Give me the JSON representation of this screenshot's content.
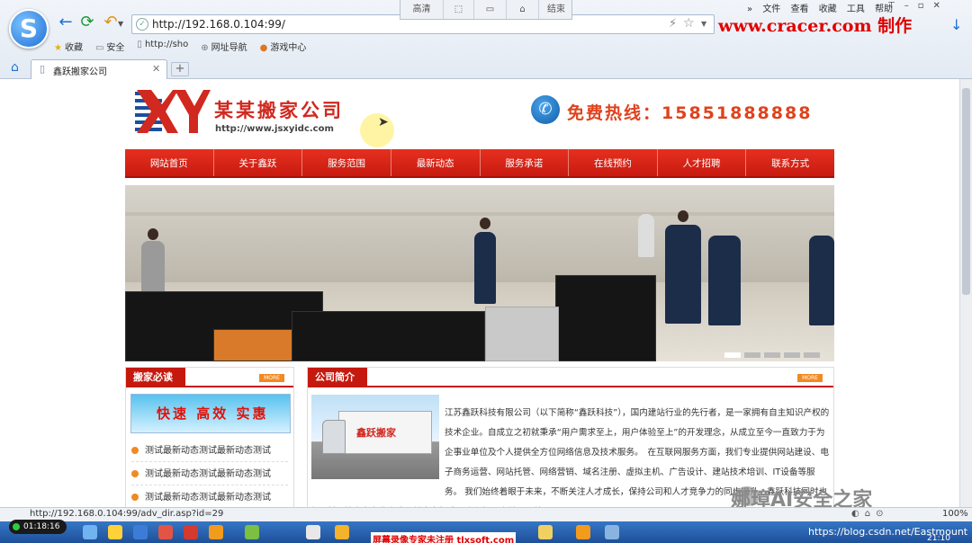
{
  "browser": {
    "url": "http://192.168.0.104:99/",
    "toolset": [
      "高清",
      "",
      "",
      "",
      "结束"
    ],
    "menu": [
      "文件",
      "查看",
      "收藏",
      "工具",
      "帮助"
    ],
    "watermark": "www.cracer.com 制作",
    "favorites": [
      "收藏",
      "安全",
      "http://sho",
      "网址导航",
      "游戏中心"
    ],
    "tab_title": "鑫跃搬家公司",
    "status_url": "http://192.168.0.104:99/adv_dir.asp?id=29",
    "zoom": "100%"
  },
  "site": {
    "company_name": "某某搬家公司",
    "site_url": "http://www.jsxyidc.com",
    "hotline": "免费热线：15851888888",
    "nav": [
      "网站首页",
      "关于鑫跃",
      "服务范围",
      "最新动态",
      "服务承诺",
      "在线预约",
      "人才招聘",
      "联系方式"
    ],
    "left_panel": {
      "title": "搬家必读",
      "more": "MORE",
      "promo": "快速 高效 实惠",
      "news": [
        "测试最新动态测试最新动态测试",
        "测试最新动态测试最新动态测试",
        "测试最新动态测试最新动态测试"
      ]
    },
    "right_panel": {
      "title": "公司简介",
      "more": "MORE",
      "truck_label": "鑫跃搬家",
      "intro": "江苏鑫跃科技有限公司（以下简称“鑫跃科技”），国内建站行业的先行者，是一家拥有自主知识产权的技术企业。自成立之初就秉承“用户需求至上，用户体验至上”的开发理念，从成立至今一直致力于为企事业单位及个人提供全方位网络信息及技术服务。　在互联网服务方面，我们专业提供网站建设、电子商务运营、网站托管、网络营销、域名注册、虚拟主机、广告设计、建站技术培训、IT设备等服务。 我们始终着眼于未来，不断关注人才成长，保持公司和人才竞争力的同步提升。鑫跃科技同时也在不断吸纳众多专业人才，并全力打造一个积极、高效、开放…"
    }
  },
  "taskbar": {
    "timer": "01:18:16",
    "record_label": "屏幕录像专家未注册 tlxsoft.com",
    "clock": "21:10"
  },
  "overlay": {
    "wechat": "娜璋AI安全之家",
    "csdn": "https://blog.csdn.net/Eastmount"
  },
  "colors": {
    "accent_red": "#c5190f",
    "brand_blue": "#1e6fd6",
    "more_orange": "#f08a24"
  }
}
